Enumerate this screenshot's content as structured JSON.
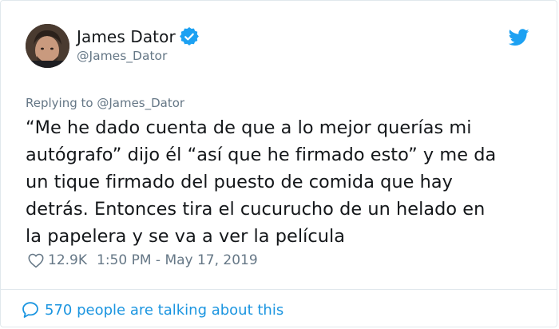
{
  "author": {
    "display_name": "James Dator",
    "handle": "@James_Dator",
    "verified": true,
    "avatar_icon": "avatar-photo"
  },
  "reply": {
    "prefix": "Replying to ",
    "handle": "@James_Dator"
  },
  "tweet": {
    "lines": [
      "“Me he dado cuenta de que a lo mejor querías mi",
      "autógrafo” dijo él “así que he firmado esto” y me da",
      "un tique firmado del puesto de comida que hay",
      "detrás. Entonces tira el cucurucho de un helado en",
      "la papelera y se va a ver la película"
    ]
  },
  "meta": {
    "like_count": "12.9K",
    "timestamp": "1:50 PM - May 17, 2019"
  },
  "footer": {
    "talking_text": "570 people are talking about this"
  },
  "icons": {
    "brand": "twitter-bird-icon",
    "verified": "verified-badge-icon",
    "like": "heart-icon",
    "conversation": "speech-bubble-icon"
  },
  "colors": {
    "brand_blue": "#1da1f2",
    "link_blue": "#1b95e0",
    "text": "#14171a",
    "secondary_text": "#657786",
    "border": "#e1e8ed"
  }
}
